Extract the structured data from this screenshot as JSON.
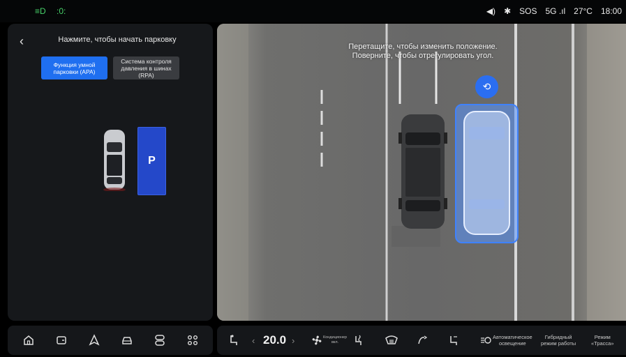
{
  "status_bar": {
    "volume_icon": "speaker-icon",
    "bluetooth_icon": "bluetooth-icon",
    "sos": "SOS",
    "network": "5G",
    "temperature": "27°C",
    "time": "18:00"
  },
  "left_panel": {
    "title": "Нажмите, чтобы начать парковку",
    "mode_apa": "Функция умной парковки (APA)",
    "mode_rpa": "Система контроля давления в шинах (RPA)",
    "slot_label": "P"
  },
  "camera": {
    "hint_line1": "Перетащите, чтобы изменить положение.",
    "hint_line2": "Поверните, чтобы отрегулировать угол."
  },
  "bottom_nav": {
    "items": [
      "home-icon",
      "car-door-icon",
      "navigation-icon",
      "car-front-icon",
      "toggle-icon",
      "apps-grid-icon"
    ]
  },
  "climate": {
    "temperature": "20.0",
    "left_arrow": "‹",
    "right_arrow": "›",
    "ac_label_line1": "Кондиционер",
    "ac_label_line2": "вкл.",
    "auto_light_line1": "Автоматическое",
    "auto_light_line2": "освещение",
    "hybrid_line1": "Гибридный",
    "hybrid_line2": "режим работы",
    "mode_line1": "Режим",
    "mode_line2": "«Трасса»"
  },
  "colors": {
    "accent": "#1f6ff0",
    "slot_blue": "#2448c9",
    "indicator_green": "#48d26a"
  }
}
